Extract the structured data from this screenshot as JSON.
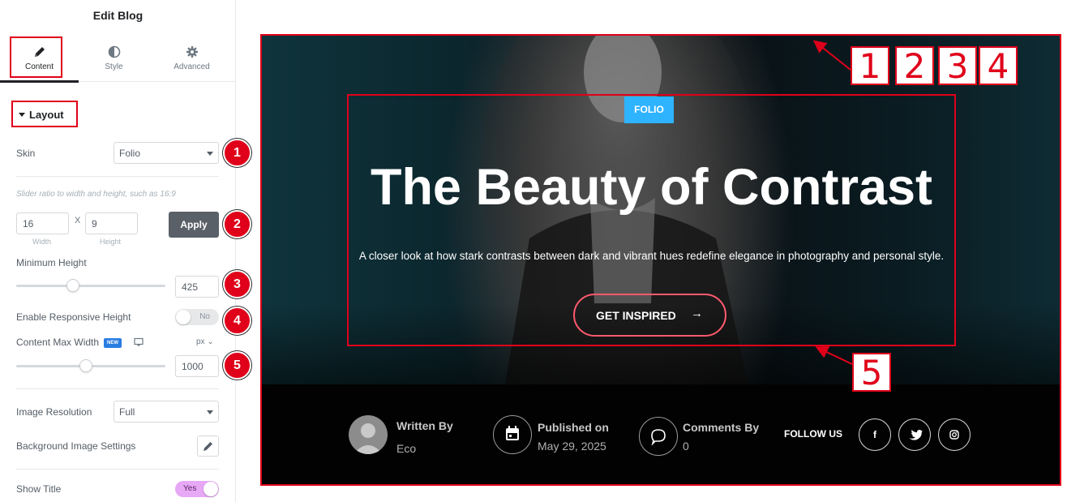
{
  "panel": {
    "title": "Edit Blog"
  },
  "tabs": [
    {
      "label": "Content",
      "icon": "pencil-icon",
      "active": true
    },
    {
      "label": "Style",
      "icon": "contrast-icon",
      "active": false
    },
    {
      "label": "Advanced",
      "icon": "gear-icon",
      "active": false
    }
  ],
  "layout": {
    "section_label": "Layout",
    "skin": {
      "label": "Skin",
      "value": "Folio"
    },
    "ratio": {
      "hint": "Slider ratio to width and height, such as 16:9",
      "width": "16",
      "height": "9",
      "width_label": "Width",
      "height_label": "Height",
      "sep": "X",
      "apply": "Apply"
    },
    "min_height": {
      "label": "Minimum Height",
      "value": "425",
      "level": 0.38
    },
    "responsive_height": {
      "label": "Enable Responsive Height",
      "state": "No"
    },
    "content_max_width": {
      "label": "Content Max Width",
      "badge": "NEW",
      "unit": "px",
      "value": "1000",
      "level": 0.47
    },
    "image_resolution": {
      "label": "Image Resolution",
      "value": "Full"
    },
    "bg_settings": {
      "label": "Background Image Settings"
    },
    "show_title": {
      "label": "Show Title",
      "state": "Yes"
    }
  },
  "callouts": [
    "1",
    "2",
    "3",
    "4",
    "5"
  ],
  "preview_markers": [
    "1",
    "2",
    "3",
    "4",
    "5"
  ],
  "preview": {
    "tag": "FOLIO",
    "title": "The Beauty of Contrast",
    "subtitle": "A closer look at how stark contrasts between dark and vibrant hues redefine elegance in photography and personal style.",
    "cta": {
      "label": "GET INSPIRED",
      "arrow": "→"
    },
    "author": {
      "title": "Written By",
      "value": "Eco"
    },
    "published": {
      "title": "Published on",
      "value": "May 29, 2025"
    },
    "comments": {
      "title": "Comments By",
      "value": "0"
    },
    "follow_label": "FOLLOW US",
    "social": [
      {
        "icon": "facebook-icon",
        "glyph": "f"
      },
      {
        "icon": "twitter-icon",
        "glyph": "t"
      },
      {
        "icon": "instagram-icon",
        "glyph": "ig"
      }
    ]
  },
  "colors": {
    "accent": "#e0001a",
    "tag_blue": "#2eb3ff",
    "cta_border": "#ff5a6e",
    "toggle_on": "#e7a8f5"
  }
}
